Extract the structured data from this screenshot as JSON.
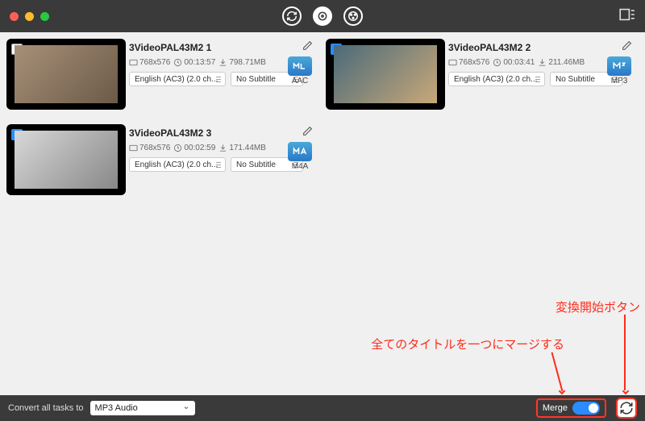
{
  "videos": [
    {
      "title": "3VideoPAL43M2 1",
      "resolution": "768x576",
      "duration": "00:13:57",
      "size": "798.71MB",
      "format": "AAC",
      "audio": "English (AC3) (2.0 ch...",
      "subtitle": "No Subtitle",
      "checked": false
    },
    {
      "title": "3VideoPAL43M2 2",
      "resolution": "768x576",
      "duration": "00:03:41",
      "size": "211.46MB",
      "format": "MP3",
      "audio": "English (AC3) (2.0 ch...",
      "subtitle": "No Subtitle",
      "checked": true
    },
    {
      "title": "3VideoPAL43M2 3",
      "resolution": "768x576",
      "duration": "00:02:59",
      "size": "171.44MB",
      "format": "M4A",
      "audio": "English (AC3) (2.0 ch...",
      "subtitle": "No Subtitle",
      "checked": true
    }
  ],
  "bottombar": {
    "convert_label": "Convert all tasks to",
    "format_value": "MP3 Audio",
    "merge_label": "Merge"
  },
  "annotations": {
    "convert_button": "変換開始ボタン",
    "merge_all": "全てのタイトルを一つにマージする"
  }
}
